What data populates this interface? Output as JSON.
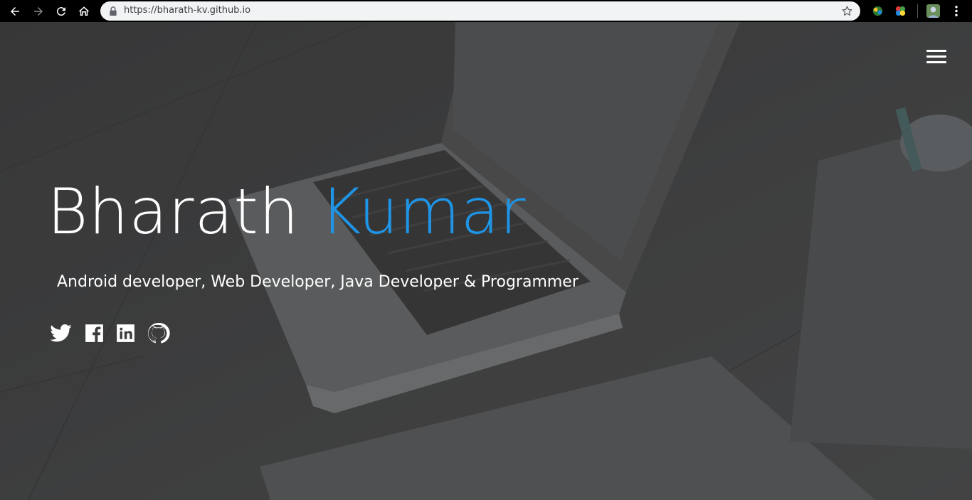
{
  "browser": {
    "url": "https://bharath-kv.github.io",
    "icons": [
      "back-icon",
      "forward-icon",
      "reload-icon",
      "home-icon",
      "lock-icon",
      "star-icon",
      "extension-icon",
      "extension-icon",
      "profile-avatar",
      "menu-kebab-icon"
    ]
  },
  "hero": {
    "first_name": "Bharath",
    "last_name": "Kumar",
    "tagline": "Android developer, Web Developer, Java Developer & Programmer",
    "menu_icon": "hamburger-icon",
    "social_links": [
      "twitter-icon",
      "facebook-icon",
      "linkedin-icon",
      "github-icon"
    ],
    "colors": {
      "accent": "#1e95e6",
      "text": "#ffffff",
      "overlay": "#4a4b4c"
    }
  }
}
